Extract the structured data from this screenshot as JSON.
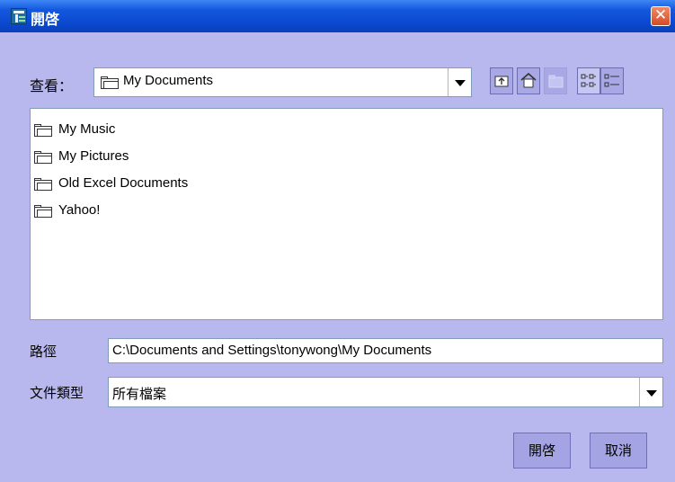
{
  "window": {
    "title": "開啓"
  },
  "lookin": {
    "label": "查看：",
    "value": "My Documents"
  },
  "toolbar": {
    "buttons": [
      {
        "name": "up-one-level-icon"
      },
      {
        "name": "home-icon"
      },
      {
        "name": "new-folder-icon"
      },
      {
        "name": "list-view-icon"
      },
      {
        "name": "details-view-icon"
      }
    ]
  },
  "files": [
    {
      "name": "My Music",
      "type": "folder"
    },
    {
      "name": "My Pictures",
      "type": "folder"
    },
    {
      "name": "Old Excel Documents",
      "type": "folder"
    },
    {
      "name": "Yahoo!",
      "type": "folder"
    }
  ],
  "path": {
    "label": "路徑",
    "value": "C:\\Documents and Settings\\tonywong\\My Documents"
  },
  "filetype": {
    "label": "文件類型",
    "value": "所有檔案"
  },
  "buttons": {
    "open": "開啓",
    "cancel": "取消"
  }
}
